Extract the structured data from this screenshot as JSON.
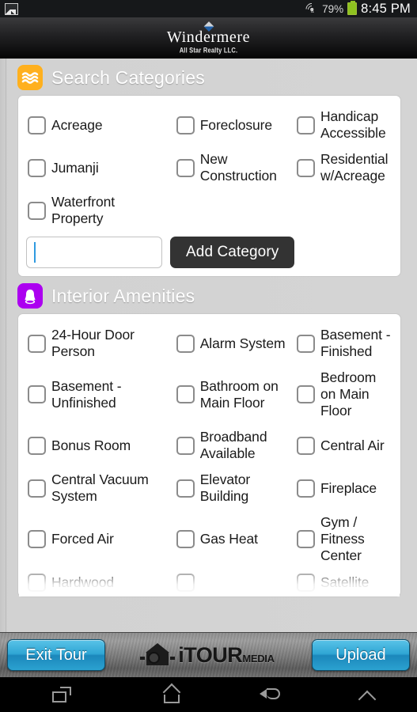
{
  "status_bar": {
    "notification_icon": "image-notification-icon",
    "wifi_icon": "wifi-icon",
    "battery_percent": "79%",
    "battery_icon": "battery-icon",
    "time": "8:45 PM"
  },
  "brand_header": {
    "logo_icon": "windermere-diamond-icon",
    "name": "Windermere",
    "subtitle": "All Star Realty LLC."
  },
  "sections": [
    {
      "id": "search-categories",
      "title": "Search Categories",
      "icon": "waves-icon",
      "icon_color": "#ffb01e",
      "items": [
        "Acreage",
        "Foreclosure",
        "Handicap Accessible",
        "Jumanji",
        "New Construction",
        "Residential w/Acreage",
        "Waterfront Property"
      ],
      "add_field": {
        "value": "",
        "placeholder": ""
      },
      "add_button": "Add Category"
    },
    {
      "id": "interior-amenities",
      "title": "Interior Amenities",
      "icon": "bell-icon",
      "icon_color": "#ac00f0",
      "items": [
        "24-Hour Door Person",
        "Alarm System",
        "Basement - Finished",
        "Basement - Unfinished",
        "Bathroom on Main Floor",
        "Bedroom on Main Floor",
        "Bonus Room",
        "Broadband Available",
        "Central Air",
        "Central Vacuum System",
        "Elevator Building",
        "Fireplace",
        "Forced Air",
        "Gas Heat",
        "Gym / Fitness Center",
        "Hardwood",
        "",
        "Satellite"
      ]
    }
  ],
  "toolbar": {
    "exit_label": "Exit Tour",
    "upload_label": "Upload",
    "logo_icon": "itour-house-camera-icon",
    "logo_main": "iTOUR",
    "logo_sub": "MEDIA"
  },
  "nav_bar": {
    "recents": "recents-icon",
    "home": "home-icon",
    "back": "back-icon",
    "up": "chevron-up-icon"
  }
}
